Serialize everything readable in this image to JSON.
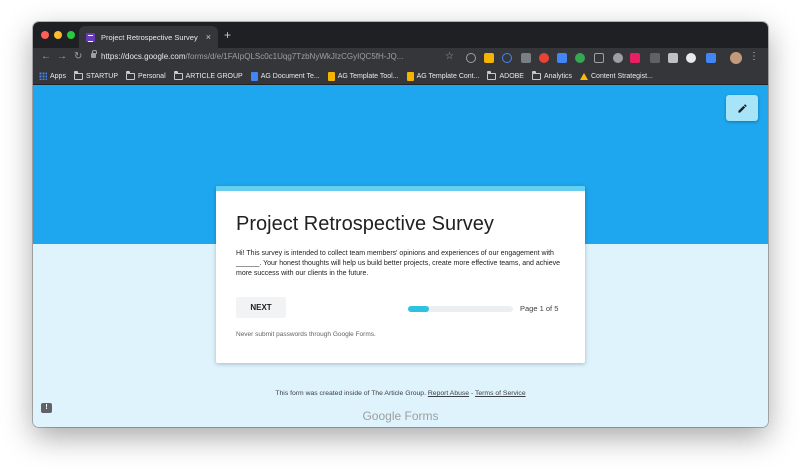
{
  "browser": {
    "tab_title": "Project Retrospective Survey",
    "tab_close": "×",
    "new_tab": "+",
    "url_host": "https://docs.google.com",
    "url_path": "/forms/d/e/1FAIpQLSc0c1Uqg7TzbNyWkJIzCGyIQC5fH-JQ...",
    "nav_back": "←",
    "nav_forward": "→",
    "nav_reload": "↻",
    "star": "☆",
    "menu": "⋮"
  },
  "bookmarks": [
    {
      "label": "Apps",
      "icon": "apps-grid-icon"
    },
    {
      "label": "STARTUP",
      "icon": "folder-icon"
    },
    {
      "label": "Personal",
      "icon": "folder-icon"
    },
    {
      "label": "ARTICLE GROUP",
      "icon": "folder-icon"
    },
    {
      "label": "AG Document Te...",
      "icon": "google-docs-icon"
    },
    {
      "label": "AG Template Tool...",
      "icon": "google-slides-icon"
    },
    {
      "label": "AG Template Cont...",
      "icon": "google-slides-icon"
    },
    {
      "label": "ADOBE",
      "icon": "folder-icon"
    },
    {
      "label": "Analytics",
      "icon": "folder-icon"
    },
    {
      "label": "Content Strategist...",
      "icon": "google-drive-icon"
    }
  ],
  "form": {
    "title": "Project Retrospective Survey",
    "description": "Hi! This survey is intended to collect team members' opinions and experiences of our engagement with ______. Your honest thoughts will help us build better projects, create more effective teams, and achieve more success with our clients in the future.",
    "next_label": "NEXT",
    "progress_fraction": 0.2,
    "page_label": "Page 1 of 5",
    "password_warning": "Never submit passwords through Google Forms."
  },
  "footer": {
    "prefix": "This form was created inside of The Article Group. ",
    "report_abuse": "Report Abuse",
    "separator": " - ",
    "terms": "Terms of Service",
    "brand_google": "Google",
    "brand_forms": " Forms"
  },
  "colors": {
    "banner": "#1ea7ef",
    "page_bg": "#dff3fd",
    "accent": "#66cfef",
    "progress": "#2fc2e0"
  }
}
